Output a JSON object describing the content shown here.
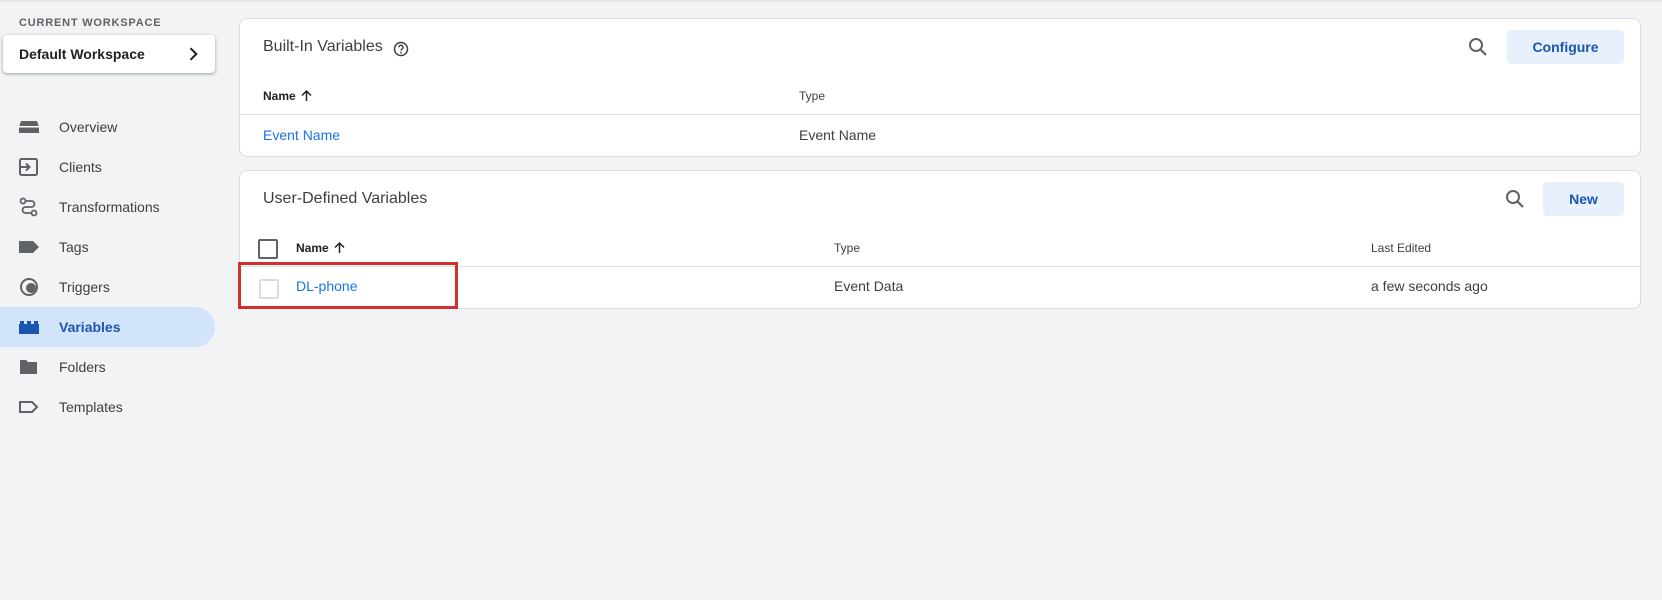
{
  "workspace": {
    "label": "CURRENT WORKSPACE",
    "name": "Default Workspace"
  },
  "nav": {
    "items": [
      {
        "label": "Overview",
        "icon": "overview-icon"
      },
      {
        "label": "Clients",
        "icon": "clients-icon"
      },
      {
        "label": "Transformations",
        "icon": "transformations-icon"
      },
      {
        "label": "Tags",
        "icon": "tag-icon"
      },
      {
        "label": "Triggers",
        "icon": "trigger-icon"
      },
      {
        "label": "Variables",
        "icon": "variables-icon",
        "active": true
      },
      {
        "label": "Folders",
        "icon": "folder-icon"
      },
      {
        "label": "Templates",
        "icon": "template-icon"
      }
    ]
  },
  "builtin": {
    "title": "Built-In Variables",
    "configure_label": "Configure",
    "columns": {
      "name": "Name",
      "type": "Type"
    },
    "rows": [
      {
        "name": "Event Name",
        "type": "Event Name"
      }
    ]
  },
  "userdefined": {
    "title": "User-Defined Variables",
    "new_label": "New",
    "columns": {
      "name": "Name",
      "type": "Type",
      "last_edited": "Last Edited"
    },
    "rows": [
      {
        "name": "DL-phone",
        "type": "Event Data",
        "last_edited": "a few seconds ago"
      }
    ]
  },
  "colors": {
    "accent": "#1a73e8",
    "active_nav_bg": "#d2e3fc",
    "highlight": "#d32f2f",
    "button_bg": "#e8f0fe"
  }
}
